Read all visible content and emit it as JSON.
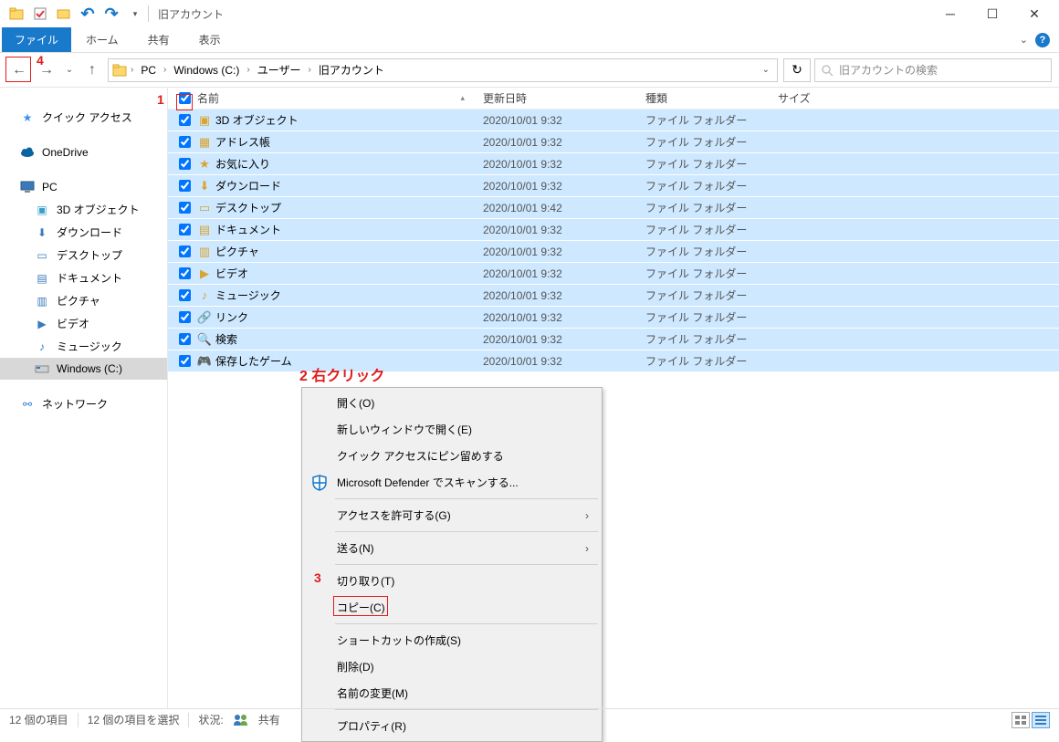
{
  "window": {
    "title": "旧アカウント"
  },
  "ribbon": {
    "file": "ファイル",
    "tabs": [
      "ホーム",
      "共有",
      "表示"
    ]
  },
  "breadcrumbs": [
    "PC",
    "Windows (C:)",
    "ユーザー",
    "旧アカウント"
  ],
  "search": {
    "placeholder": "旧アカウントの検索"
  },
  "tree": {
    "quick": "クイック アクセス",
    "onedrive": "OneDrive",
    "pc": "PC",
    "pc_children": [
      "3D オブジェクト",
      "ダウンロード",
      "デスクトップ",
      "ドキュメント",
      "ピクチャ",
      "ビデオ",
      "ミュージック",
      "Windows (C:)"
    ],
    "network": "ネットワーク"
  },
  "columns": {
    "name": "名前",
    "date": "更新日時",
    "type": "種類",
    "size": "サイズ"
  },
  "rows": [
    {
      "name": "3D オブジェクト",
      "date": "2020/10/01 9:32",
      "type": "ファイル フォルダー"
    },
    {
      "name": "アドレス帳",
      "date": "2020/10/01 9:32",
      "type": "ファイル フォルダー"
    },
    {
      "name": "お気に入り",
      "date": "2020/10/01 9:32",
      "type": "ファイル フォルダー"
    },
    {
      "name": "ダウンロード",
      "date": "2020/10/01 9:32",
      "type": "ファイル フォルダー"
    },
    {
      "name": "デスクトップ",
      "date": "2020/10/01 9:42",
      "type": "ファイル フォルダー"
    },
    {
      "name": "ドキュメント",
      "date": "2020/10/01 9:32",
      "type": "ファイル フォルダー"
    },
    {
      "name": "ピクチャ",
      "date": "2020/10/01 9:32",
      "type": "ファイル フォルダー"
    },
    {
      "name": "ビデオ",
      "date": "2020/10/01 9:32",
      "type": "ファイル フォルダー"
    },
    {
      "name": "ミュージック",
      "date": "2020/10/01 9:32",
      "type": "ファイル フォルダー"
    },
    {
      "name": "リンク",
      "date": "2020/10/01 9:32",
      "type": "ファイル フォルダー"
    },
    {
      "name": "検索",
      "date": "2020/10/01 9:32",
      "type": "ファイル フォルダー"
    },
    {
      "name": "保存したゲーム",
      "date": "2020/10/01 9:32",
      "type": "ファイル フォルダー"
    }
  ],
  "ctx": {
    "open": "開く(O)",
    "newwin": "新しいウィンドウで開く(E)",
    "pin": "クイック アクセスにピン留めする",
    "defender": "Microsoft Defender でスキャンする...",
    "grant": "アクセスを許可する(G)",
    "send": "送る(N)",
    "cut": "切り取り(T)",
    "copy": "コピー(C)",
    "shortcut": "ショートカットの作成(S)",
    "delete": "削除(D)",
    "rename": "名前の変更(M)",
    "prop": "プロパティ(R)"
  },
  "status": {
    "count": "12 個の項目",
    "sel": "12 個の項目を選択",
    "statelabel": "状況:",
    "shared": "共有"
  },
  "anno": {
    "n1": "1",
    "n2": "2 右クリック",
    "n3": "3",
    "n4": "4"
  }
}
